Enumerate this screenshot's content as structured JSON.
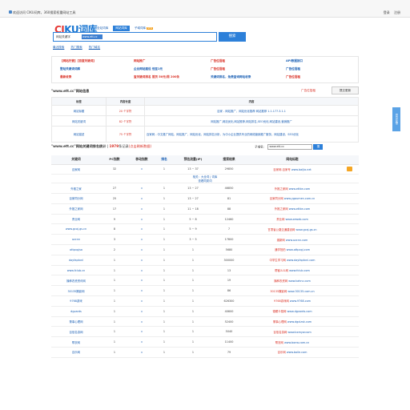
{
  "topbar": {
    "notice": "欢迎访问 CIKU词库，360搜索权重网站工具",
    "login": "登录",
    "register": "注册"
  },
  "logo": {
    "ci": "CI",
    "rest": "KU词库"
  },
  "tabs": [
    {
      "label": "全站词库",
      "active": false
    },
    {
      "label": "网站词库",
      "active": true
    },
    {
      "label": "子域词库",
      "active": false,
      "badge": "NEW"
    }
  ],
  "search": {
    "select_label": "网站关键字",
    "value": "www.ett.cc",
    "button": "搜索"
  },
  "subnav": [
    "最近搜索",
    "热门搜索",
    "热门域名"
  ],
  "promo": [
    {
      "text": "【网站托管】【百度关键词】",
      "color": "#d93025"
    },
    {
      "text": "网站推广",
      "color": "#d93025"
    },
    {
      "text": "广告位招租",
      "color": "#d93025"
    },
    {
      "text": "API数据接口",
      "color": "#1a5fb4"
    },
    {
      "text": "整站关键词词库",
      "color": "#1a5fb4"
    },
    {
      "text": "企业网站建设 低至1元",
      "color": "#1a5fb4"
    },
    {
      "text": "广告位招租",
      "color": "#d93025"
    },
    {
      "text": "广告位招租",
      "color": "#1a5fb4"
    },
    {
      "text": "最新收录",
      "color": "#d93025"
    },
    {
      "text": "查关键词排名 首页 50元/周 200条",
      "color": "#d93025"
    },
    {
      "text": "关键词排名，免费查询网站收录",
      "color": "#1a5fb4"
    },
    {
      "text": "广告位招租",
      "color": "#d93025"
    }
  ],
  "info": {
    "title": "\"www.ett.cc\"网站信息",
    "ad_link": "广告位招租",
    "share_button": "提交更新",
    "headers": [
      "标签",
      "内容长度",
      "内容"
    ],
    "rows": [
      {
        "label": "网站标题",
        "length": "20 个字符",
        "content": "百家 - 网站推广，网站优化推荐 网站推荐 1.1.177.3.1.1"
      },
      {
        "label": "网站关键词",
        "length": "82 个字符",
        "content": "网站推广,网站优化,网站推荐,网站排名,SEO优化,网站建设,营销推广"
      },
      {
        "label": "网站描述",
        "length": "75 个字符",
        "content": "百家网 - 中文推广网站，网站推广，网站优化，网站排名分析，为中小企业提供专业的网络营销推广服务，网站建设，SEO优化"
      }
    ]
  },
  "keywords": {
    "title_prefix": "\"www.ett.cc\"网站关键词排名统计",
    "count_label": "1979",
    "count_suffix": "条记录",
    "update_label": "(点击刷新数据)",
    "filter_label": "子域名：",
    "filter_value": "www.ett.cc",
    "filter_button": "搜",
    "headers": [
      "关键词",
      "PC指数",
      "移动指数",
      "排名",
      "预估流量(IP)",
      "搜索结果",
      "网站标题"
    ],
    "sub_row_text": "相关：大全词 | 词库",
    "sub_row_text2": "查看同类词",
    "rows": [
      {
        "kw": "百家网",
        "pc": "32",
        "mobile": "0",
        "rank": "1",
        "ip": "13 ~ 37",
        "results": "29850",
        "title": "百家网-百家号",
        "domain": "www.baijia.net",
        "download": true
      },
      {
        "kw": "外推之家",
        "pc": "27",
        "mobile": "0",
        "rank": "1",
        "ip": "13 ~ 27",
        "results": "46850",
        "title": "外推之家网",
        "domain": "www.ettbn.com",
        "download": false
      },
      {
        "kw": "百家同分网",
        "pc": "25",
        "mobile": "0",
        "rank": "1",
        "ip": "13 ~ 27",
        "results": "81",
        "title": "百家同分网",
        "domain": "www.ygaumen.com.cn",
        "download": false
      },
      {
        "kw": "外推之家网",
        "pc": "17",
        "mobile": "0",
        "rank": "1",
        "ip": "11 ~ 18",
        "results": "88",
        "title": "外推之家网",
        "domain": "www.ettbn.com",
        "download": false
      },
      {
        "kw": "责业网",
        "pc": "9",
        "mobile": "0",
        "rank": "1",
        "ip": "5 ~ 8",
        "results": "12460",
        "title": "责业网",
        "domain": "www.zeweb.com",
        "download": false
      },
      {
        "kw": "www.gcaj.gs.cn",
        "pc": "8",
        "mobile": "0",
        "rank": "1",
        "ip": "5 ~ 9",
        "results": "7",
        "title": "甘肃省公路交通建设网",
        "domain": "www.gcaj.gs.cn",
        "download": false
      },
      {
        "kw": "ozcnn",
        "pc": "3",
        "mobile": "0",
        "rank": "1",
        "ip": "3 ~ 5",
        "results": "17800",
        "title": "澳新网",
        "domain": "www.ozcnn.com",
        "download": false
      },
      {
        "kw": "ottpxpjsa",
        "pc": "2",
        "mobile": "0",
        "rank": "1",
        "ip": "1",
        "results": "5680",
        "title": "通学拍拍",
        "domain": "www.ottpxpj.com",
        "download": false
      },
      {
        "kw": "dayfaptxnl",
        "pc": "1",
        "mobile": "0",
        "rank": "1",
        "ip": "1",
        "results": "300000",
        "title": "中学生学习网",
        "domain": "www.dayfaptxnl.com",
        "download": false
      },
      {
        "kw": "www.fclub.cn",
        "pc": "1",
        "mobile": "0",
        "rank": "1",
        "ip": "1",
        "results": "13",
        "title": "帮客么么网",
        "domain": "www.fclub.com",
        "download": false
      },
      {
        "kw": "播种农资资讯网",
        "pc": "1",
        "mobile": "0",
        "rank": "1",
        "ip": "1",
        "results": "19",
        "title": "播种农资网",
        "domain": "www.bzhnc.com",
        "download": false
      },
      {
        "kw": "30135撒影网",
        "pc": "1",
        "mobile": "0",
        "rank": "1",
        "ip": "1",
        "results": "86",
        "title": "30135撒影网",
        "domain": "www.30135.com.cn",
        "download": false
      },
      {
        "kw": "9768游戏",
        "pc": "1",
        "mobile": "0",
        "rank": "1",
        "ip": "1",
        "results": "626300",
        "title": "9768游戏网",
        "domain": "www.9768.com",
        "download": false
      },
      {
        "kw": "dgvards",
        "pc": "1",
        "mobile": "0",
        "rank": "1",
        "ip": "1",
        "results": "40600",
        "title": "德耀卡易网",
        "domain": "www.dgvards.com",
        "download": false
      },
      {
        "kw": "董事心理网",
        "pc": "1",
        "mobile": "0",
        "rank": "1",
        "ip": "1",
        "results": "52400",
        "title": "董事心理网",
        "domain": "www.dgxlzsk.com",
        "download": false
      },
      {
        "kw": "百信名游网",
        "pc": "1",
        "mobile": "0",
        "rank": "1",
        "ip": "1",
        "results": "5040",
        "title": "百信名游网",
        "domain": "www.bxmyw.com",
        "download": false
      },
      {
        "kw": "帮农网",
        "pc": "1",
        "mobile": "0",
        "rank": "1",
        "ip": "1",
        "results": "11400",
        "title": "帮农网",
        "domain": "www.bonw.com.cn",
        "download": false
      },
      {
        "kw": "百乐网",
        "pc": "1",
        "mobile": "0",
        "rank": "1",
        "ip": "1",
        "results": "79",
        "title": "百乐网",
        "domain": "www.baile.com",
        "download": false
      }
    ]
  },
  "side_tab": "意见反馈",
  "colors": {
    "brand": "#1976d2",
    "accent_red": "#d93025",
    "link_blue": "#1a5fb4",
    "button_blue": "#2d80d9"
  }
}
